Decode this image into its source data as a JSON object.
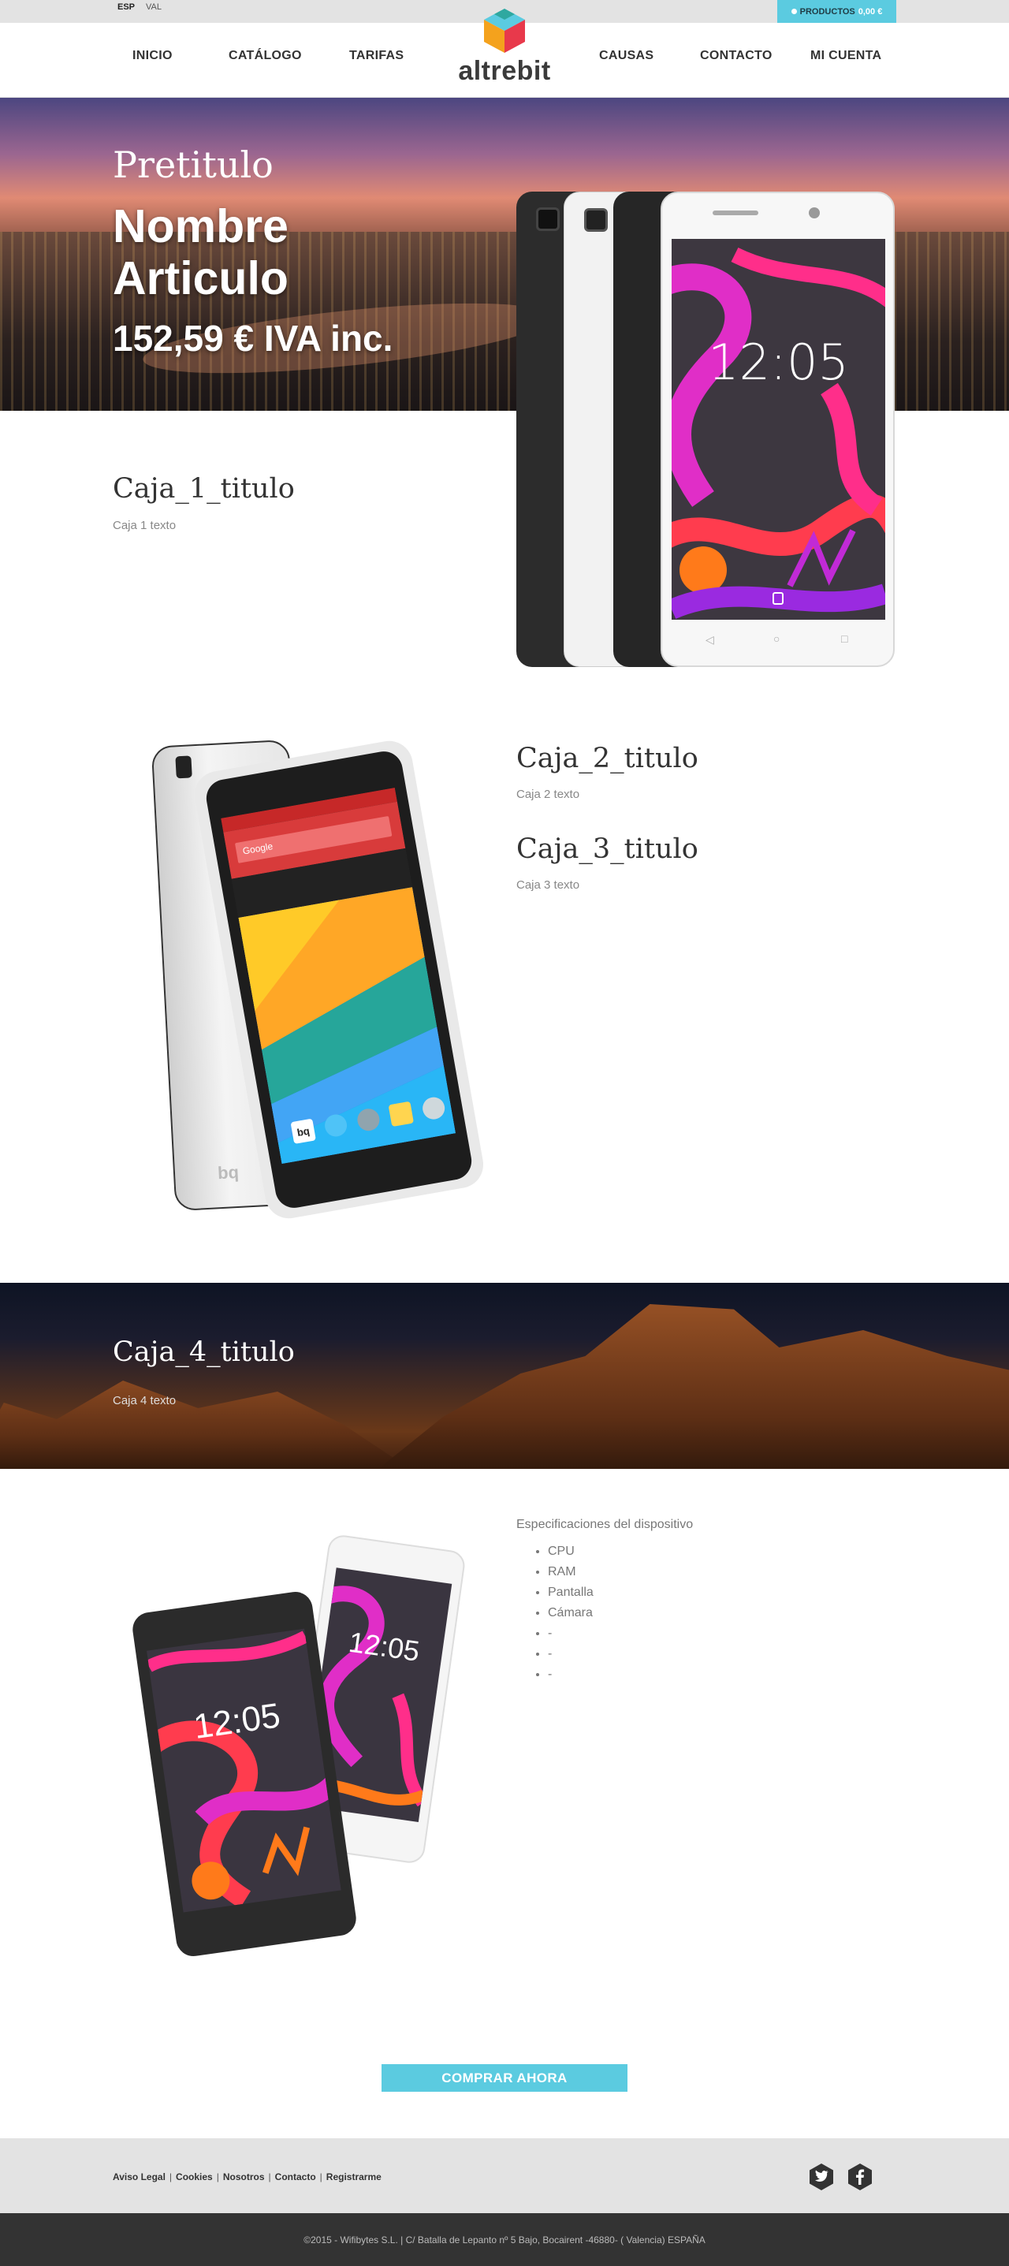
{
  "topbar": {
    "languages": [
      "ESP",
      "VAL"
    ],
    "cart_label": "PRODUCTOS",
    "cart_total": "0,00 €"
  },
  "brand": {
    "name": "altrebit",
    "colors": {
      "cyan": "#5bcbe0",
      "red": "#e8394b",
      "orange": "#f4a21d",
      "teal": "#2fa8a0"
    }
  },
  "nav": {
    "left": [
      "INICIO",
      "CATÁLOGO",
      "TARIFAS"
    ],
    "right": [
      "CAUSAS",
      "CONTACTO",
      "MI CUENTA"
    ]
  },
  "hero": {
    "pretitle": "Pretitulo",
    "name_line1": "Nombre",
    "name_line2": "Articulo",
    "price": "152,59 € IVA inc.",
    "phone_time": "12:05"
  },
  "boxes": {
    "box1": {
      "title": "Caja_1_titulo",
      "text": "Caja 1 texto"
    },
    "box2": {
      "title": "Caja_2_titulo",
      "text": "Caja 2 texto"
    },
    "box3": {
      "title": "Caja_3_titulo",
      "text": "Caja 3 texto"
    },
    "box4": {
      "title": "Caja_4_titulo",
      "text": "Caja 4 texto"
    }
  },
  "phone2": {
    "search_label": "Google",
    "brand_mark": "bq"
  },
  "specs": {
    "title": "Especificaciones del dispositivo",
    "items": [
      "CPU",
      "RAM",
      "Pantalla",
      "Cámara",
      "-",
      "-",
      "-"
    ],
    "phone_time": "12:05"
  },
  "buy_button": {
    "label": "COMPRAR AHORA"
  },
  "footer": {
    "links": [
      "Aviso Legal",
      "Cookies",
      "Nosotros",
      "Contacto",
      "Registrarme"
    ],
    "social": [
      "twitter-icon",
      "facebook-icon"
    ],
    "copyright": "©2015 - Wifibytes S.L. | C/ Batalla de Lepanto nº 5 Bajo, Bocairent -46880- ( Valencia) ESPAÑA"
  }
}
